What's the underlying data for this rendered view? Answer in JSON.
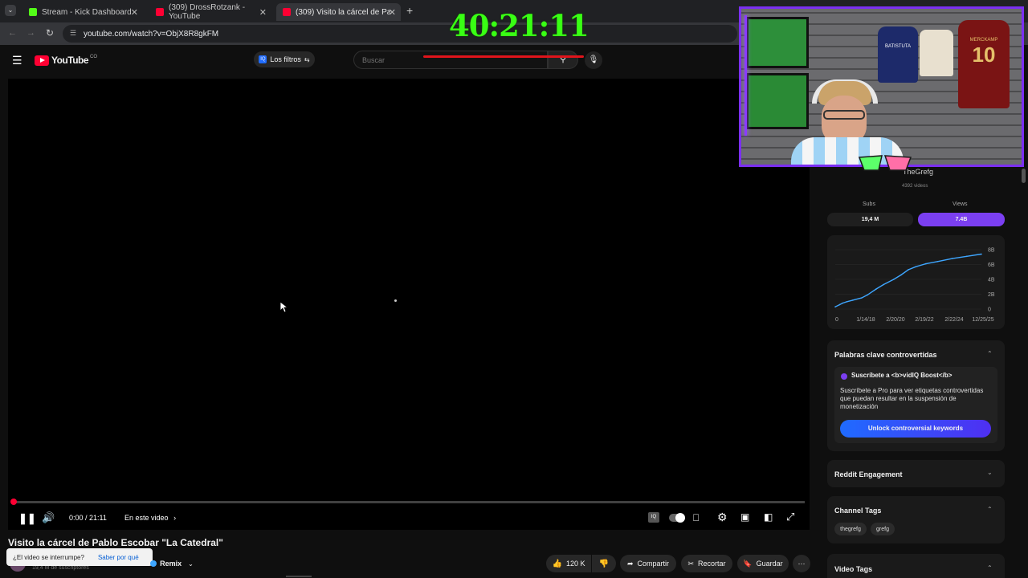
{
  "browser": {
    "tabs": [
      {
        "label": "Stream - Kick Dashboard",
        "favicon_color": "#53fc18"
      },
      {
        "label": "(309) DrossRotzank - YouTube",
        "favicon_color": "#ff0033"
      },
      {
        "label": "(309) Visito la cárcel de Pablo E",
        "favicon_color": "#ff0033"
      }
    ],
    "new_tab": "+",
    "url": "youtube.com/watch?v=ObjX8R8gkFM"
  },
  "overlay": {
    "timer": "40:21:11",
    "timer_color": "#39ff14",
    "webcam_jersey_1": "BATISTUTA",
    "webcam_jersey_2": "MERCKAMP",
    "webcam_jersey_number": "10"
  },
  "youtube": {
    "logo_text": "YouTube",
    "country_code": "CO",
    "filters_label": "Los filtros",
    "search_placeholder": "Buscar"
  },
  "player": {
    "time": "0:00 / 21:11",
    "chapters_label": "En este video",
    "progress": 0.0
  },
  "video": {
    "title": "Visito la cárcel de Pablo Escobar \"La Catedral\"",
    "subscribers": "19,4 M de suscriptores",
    "remix_label": "Remix",
    "likes": "120 K",
    "share_label": "Compartir",
    "clip_label": "Recortar",
    "save_label": "Guardar"
  },
  "interrupt_toast": {
    "question": "¿El video se interrumpe?",
    "link": "Saber por qué"
  },
  "vidiq": {
    "channel_name": "TheGrefg",
    "videos_count": "4392 videos",
    "stats_headers": [
      "Subs",
      "Views"
    ],
    "subs_value": "19,4 M",
    "views_value": "7.4B",
    "accent": "#7b3ff2",
    "chart_data": {
      "type": "line",
      "x_tick_labels": [
        "0",
        "1/14/18",
        "2/20/20",
        "2/19/22",
        "2/22/24",
        "12/25/25"
      ],
      "y_tick_labels": [
        "8B",
        "6B",
        "4B",
        "2B",
        "0"
      ],
      "ylim": [
        0,
        8
      ],
      "line_color": "#3ea6ff",
      "x": [
        0.0,
        0.03,
        0.05,
        0.08,
        0.12,
        0.18,
        0.22,
        0.28,
        0.33,
        0.4,
        0.45,
        0.5,
        0.55,
        0.62,
        0.7,
        0.8,
        0.9,
        1.0
      ],
      "values": [
        0.3,
        0.6,
        0.8,
        1.0,
        1.2,
        1.5,
        1.9,
        2.7,
        3.3,
        4.0,
        4.6,
        5.3,
        5.7,
        6.1,
        6.4,
        6.8,
        7.1,
        7.4
      ]
    },
    "keywords_title": "Palabras clave controvertidas",
    "boost_title": "Suscríbete a <b>vidIQ Boost</b>",
    "boost_text": "Suscríbete a Pro para ver etiquetas controvertidas que puedan resultar en la suspensión de monetización",
    "unlock_label": "Unlock controversial keywords",
    "unlock_color": "#1f6bff",
    "reddit_title": "Reddit Engagement",
    "channel_tags_title": "Channel Tags",
    "channel_tags": [
      "thegrefg",
      "grefg"
    ],
    "video_tags_title": "Video Tags"
  }
}
